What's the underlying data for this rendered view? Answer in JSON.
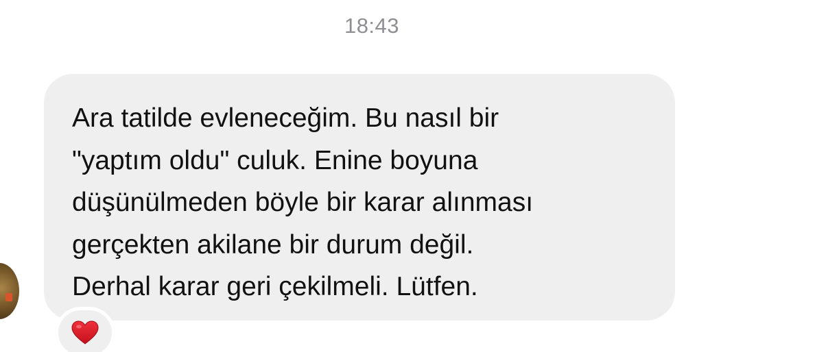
{
  "timestamp": "18:43",
  "message": {
    "text": "Ara tatilde evleneceğim. Bu nasıl bir\n\"yaptım oldu\" culuk. Enine boyuna\ndüşünülmeden böyle bir karar alınması\ngerçekten akilane bir durum değil.\nDerhal karar geri çekilmeli. Lütfen.",
    "bubble_color": "#efefef"
  },
  "reaction": {
    "icon": "red-heart-icon",
    "color": "#e0202c"
  },
  "avatar": {
    "icon": "avatar"
  }
}
